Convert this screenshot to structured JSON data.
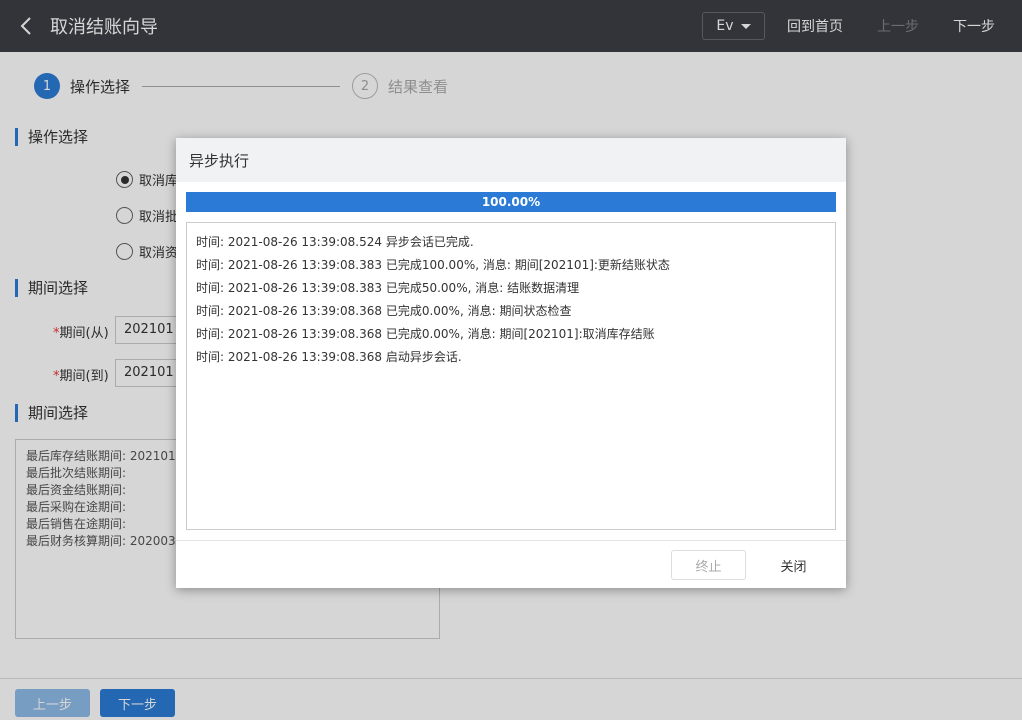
{
  "header": {
    "title": "取消结账向导",
    "lang": "Ev",
    "home_label": "回到首页",
    "prev_label": "上一步",
    "next_label": "下一步"
  },
  "stepper": {
    "steps": [
      {
        "number": "1",
        "label": "操作选择"
      },
      {
        "number": "2",
        "label": "结果查看"
      }
    ]
  },
  "operation_section": {
    "title": "操作选择",
    "options": [
      "取消库",
      "取消批",
      "取消资"
    ]
  },
  "period_section": {
    "title": "期间选择",
    "from_label": "期间(从)",
    "from_value": "202101",
    "to_label": "期间(到)",
    "to_value": "202101",
    "required_mark": "*"
  },
  "period_info_section": {
    "title": "期间选择",
    "lines": [
      "最后库存结账期间: 202101",
      "最后批次结账期间:",
      "最后资金结账期间:",
      "最后采购在途期间:",
      "最后销售在途期间:",
      "最后财务核算期间: 202003"
    ]
  },
  "footer": {
    "prev_label": "上一步",
    "next_label": "下一步"
  },
  "dialog": {
    "title": "异步执行",
    "progress": {
      "percent": 100,
      "text": "100.00%"
    },
    "log": [
      "时间: 2021-08-26 13:39:08.524 异步会话已完成.",
      "时间: 2021-08-26 13:39:08.383 已完成100.00%, 消息: 期间[202101]:更新结账状态",
      "时间: 2021-08-26 13:39:08.383 已完成50.00%, 消息: 结账数据清理",
      "时间: 2021-08-26 13:39:08.368 已完成0.00%, 消息: 期间状态检查",
      "时间: 2021-08-26 13:39:08.368 已完成0.00%, 消息: 期间[202101]:取消库存结账",
      "时间: 2021-08-26 13:39:08.368 启动异步会话."
    ],
    "stop_label": "终止",
    "close_label": "关闭"
  },
  "colors": {
    "header_bg": "#3c3f44",
    "accent": "#2b7bd6"
  }
}
